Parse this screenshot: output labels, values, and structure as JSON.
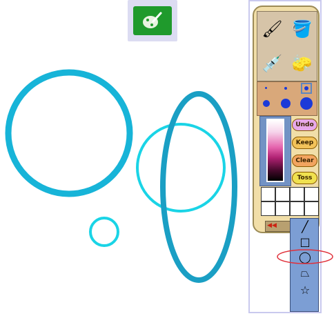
{
  "app": {
    "icon": "paint-brush-palette-icon"
  },
  "palette": {
    "tools": [
      {
        "name": "brush-icon",
        "glyph": "🖌"
      },
      {
        "name": "paint-bucket-icon",
        "glyph": "🪣"
      },
      {
        "name": "eyedropper-icon",
        "glyph": "💉"
      },
      {
        "name": "eraser-icon",
        "glyph": "🧽"
      }
    ],
    "buttons": {
      "undo": "Undo",
      "keep": "Keep",
      "clear": "Clear",
      "toss": "Toss"
    },
    "shape_tools": [
      {
        "name": "line-tool-icon",
        "glyph": "╱"
      },
      {
        "name": "rectangle-tool-icon",
        "glyph": "□"
      },
      {
        "name": "ellipse-tool-icon",
        "glyph": "◯"
      },
      {
        "name": "polygon-tool-icon",
        "glyph": "⏢"
      },
      {
        "name": "star-tool-icon",
        "glyph": "☆"
      }
    ],
    "selected_shape": "ellipse",
    "brush_color": "#1b3ad8",
    "swatches": [
      "#ffffff",
      "#ffffff",
      "#ffffff",
      "#ffffff",
      "#ffffff",
      "#ffffff",
      "#ffffff",
      "#ffffff"
    ]
  },
  "canvas": {
    "stroke_colors": [
      "#17b4d8",
      "#1ad4e6",
      "#1a9fc4"
    ]
  }
}
